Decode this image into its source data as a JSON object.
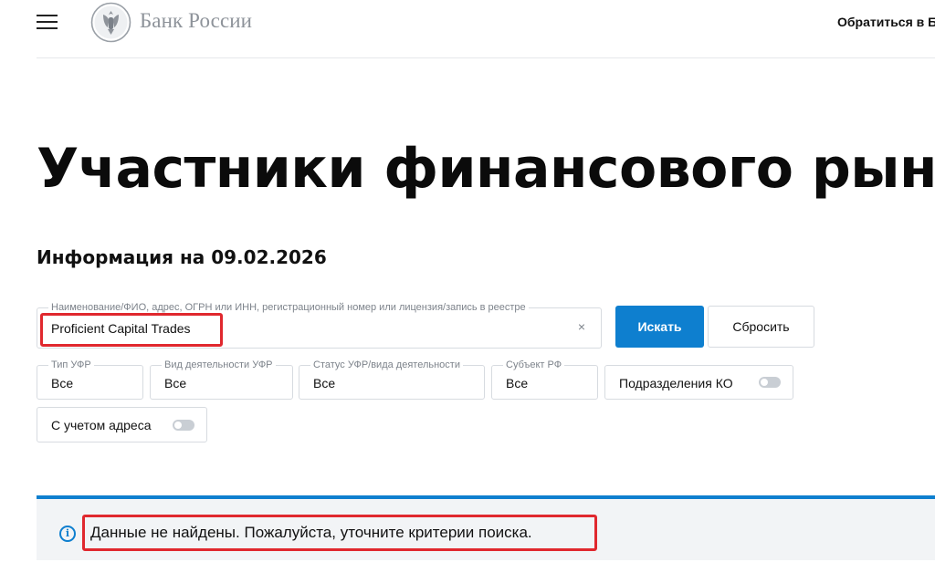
{
  "header": {
    "menu_icon": "hamburger-menu-icon",
    "logo_icon": "double-headed-eagle-emblem-icon",
    "logo_text": "Банк России",
    "contact_link": "Обратиться в Б"
  },
  "page": {
    "title": "Участники финансового рынка",
    "info_date": "Информация на 09.02.2026"
  },
  "search": {
    "label": "Наименование/ФИО, адрес, ОГРН или ИНН, регистрационный номер или лицензия/запись в реестре",
    "value": "Proficient Capital Trades",
    "clear_icon": "close-icon",
    "search_button": "Искать",
    "reset_button": "Сбросить"
  },
  "filters": {
    "type": {
      "label": "Тип УФР",
      "value": "Все"
    },
    "activity": {
      "label": "Вид деятельности УФР",
      "value": "Все"
    },
    "status": {
      "label": "Статус УФР/вида деятельности",
      "value": "Все"
    },
    "region": {
      "label": "Субъект РФ",
      "value": "Все"
    },
    "ko_subdivisions": {
      "label": "Подразделения КО",
      "enabled": false
    },
    "with_address": {
      "label": "С учетом адреса",
      "enabled": false
    }
  },
  "result": {
    "icon": "info-icon",
    "message": "Данные не найдены. Пожалуйста, уточните критерии поиска."
  },
  "colors": {
    "accent": "#0e7fcf",
    "highlight": "#e0282e",
    "banner_bg": "#f2f4f6",
    "logo_text": "#8e939a"
  }
}
